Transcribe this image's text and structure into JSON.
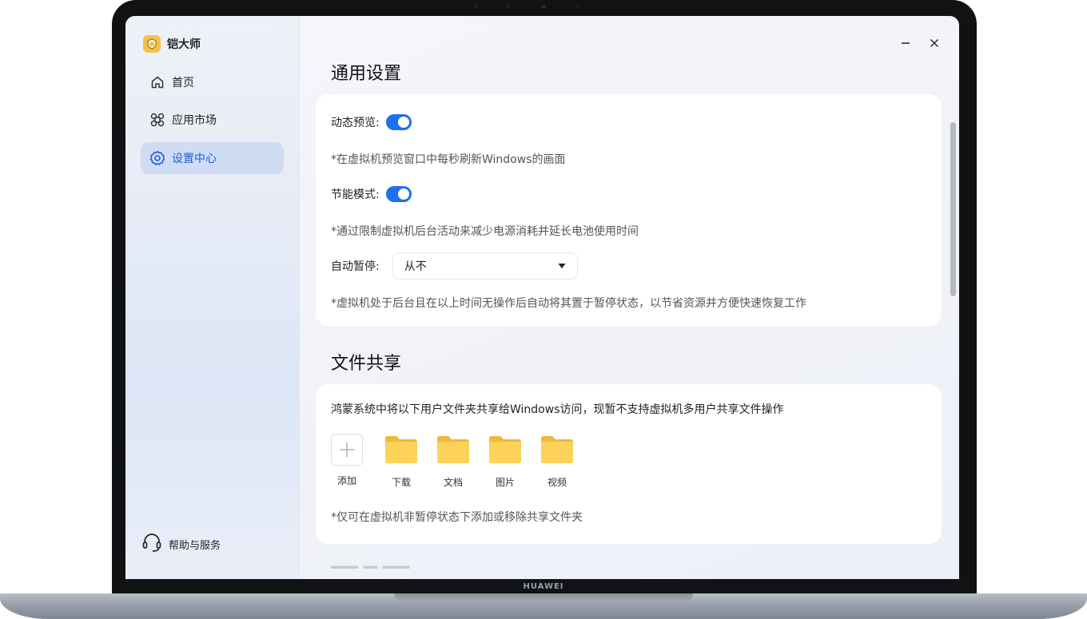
{
  "app": {
    "name": "铠大师"
  },
  "sidebar": {
    "items": [
      {
        "label": "首页",
        "icon": "home-icon"
      },
      {
        "label": "应用市场",
        "icon": "app-market-icon"
      },
      {
        "label": "设置中心",
        "icon": "gear-icon",
        "active": true
      }
    ],
    "help_label": "帮助与服务"
  },
  "general": {
    "title": "通用设置",
    "dynamic_preview": {
      "label": "动态预览:",
      "on": true,
      "hint": "*在虚拟机预览窗口中每秒刷新Windows的画面"
    },
    "power_saving": {
      "label": "节能模式:",
      "on": true,
      "hint": "*通过限制虚拟机后台活动来减少电源消耗并延长电池使用时间"
    },
    "auto_pause": {
      "label": "自动暂停:",
      "value": "从不",
      "hint": "*虚拟机处于后台且在以上时间无操作后自动将其置于暂停状态，以节省资源并方便快速恢复工作"
    }
  },
  "file_share": {
    "title": "文件共享",
    "description": "鸿蒙系统中将以下用户文件夹共享给Windows访问，现暂不支持虚拟机多用户共享文件操作",
    "add_label": "添加",
    "folders": [
      "下载",
      "文档",
      "图片",
      "视频"
    ],
    "hint": "*仅可在虚拟机非暂停状态下添加或移除共享文件夹"
  },
  "device_brand": "HUAWEI",
  "colors": {
    "accent": "#1f6ff0",
    "active_nav_bg": "#cfdcf4",
    "folder": "#f5c842"
  }
}
